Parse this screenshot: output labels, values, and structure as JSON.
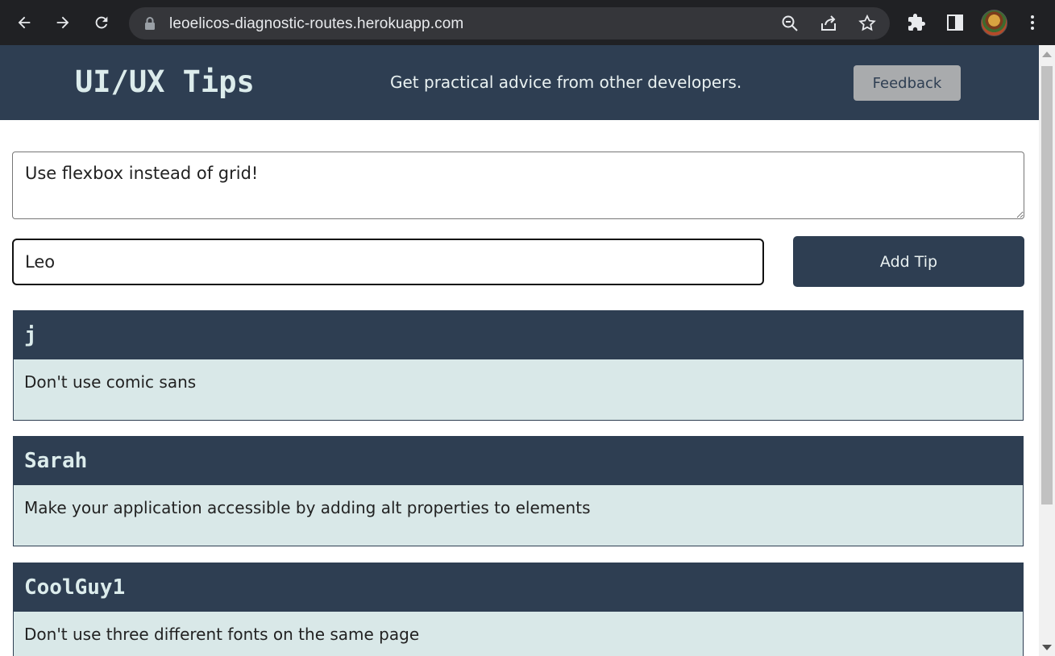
{
  "browser": {
    "url": "leoelicos-diagnostic-routes.herokuapp.com",
    "icons": [
      "back-icon",
      "forward-icon",
      "reload-icon",
      "lock-icon",
      "zoom-icon",
      "share-icon",
      "star-icon",
      "extensions-icon",
      "side-panel-icon",
      "profile-avatar",
      "menu-icon"
    ]
  },
  "header": {
    "title": "UI/UX Tips",
    "tagline": "Get practical advice from other developers.",
    "feedback_label": "Feedback"
  },
  "form": {
    "tip_value": "Use flexbox instead of grid!",
    "name_value": "Leo",
    "submit_label": "Add Tip"
  },
  "tips": [
    {
      "author": "j",
      "text": "Don't use comic sans"
    },
    {
      "author": "Sarah",
      "text": "Make your application accessible by adding alt properties to elements"
    },
    {
      "author": "CoolGuy1",
      "text": "Don't use three different fonts on the same page"
    }
  ],
  "colors": {
    "header_bg": "#2e3e52",
    "card_body_bg": "#d9e8e8",
    "button_bg": "#2e3e52",
    "feedback_bg": "#a9abad"
  }
}
